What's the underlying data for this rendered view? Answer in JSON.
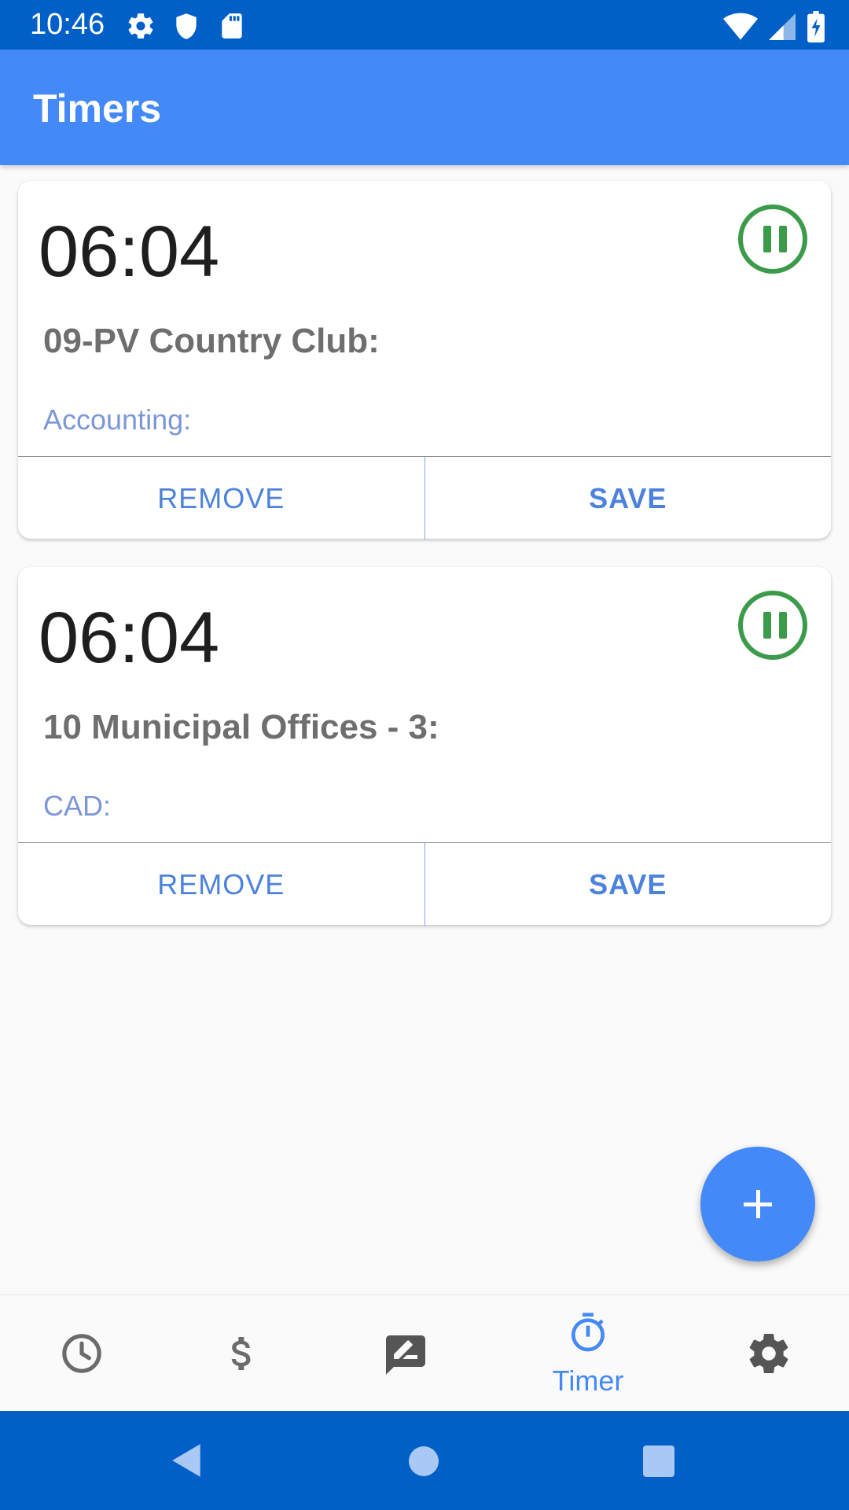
{
  "status_bar": {
    "time": "10:46",
    "left_icons": [
      "gear-icon",
      "shield-icon",
      "sd-card-icon"
    ],
    "right_icons": [
      "wifi-icon",
      "cell-signal-icon",
      "battery-charging-icon"
    ]
  },
  "app_bar": {
    "title": "Timers"
  },
  "timers": [
    {
      "time": "06:04",
      "project": "09-PV Country Club:",
      "task": "Accounting:",
      "remove_label": "REMOVE",
      "save_label": "SAVE",
      "state_icon": "pause-icon"
    },
    {
      "time": "06:04",
      "project": "10 Municipal Offices - 3:",
      "task": "CAD:",
      "remove_label": "REMOVE",
      "save_label": "SAVE",
      "state_icon": "pause-icon"
    }
  ],
  "fab": {
    "icon": "plus-icon"
  },
  "bottom_nav": {
    "items": [
      {
        "icon": "clock-icon",
        "label": ""
      },
      {
        "icon": "dollar-icon",
        "label": ""
      },
      {
        "icon": "notes-icon",
        "label": ""
      },
      {
        "icon": "stopwatch-icon",
        "label": "Timer",
        "active": true
      },
      {
        "icon": "settings-icon",
        "label": ""
      }
    ]
  },
  "system_nav": {
    "icons": [
      "back-icon",
      "home-icon",
      "recents-icon"
    ]
  },
  "colors": {
    "status_bar": "#0060c8",
    "app_bar": "#4489f8",
    "accent": "#4489f8",
    "pause_green": "#3c9b4a",
    "task_text": "#7c97d8"
  }
}
